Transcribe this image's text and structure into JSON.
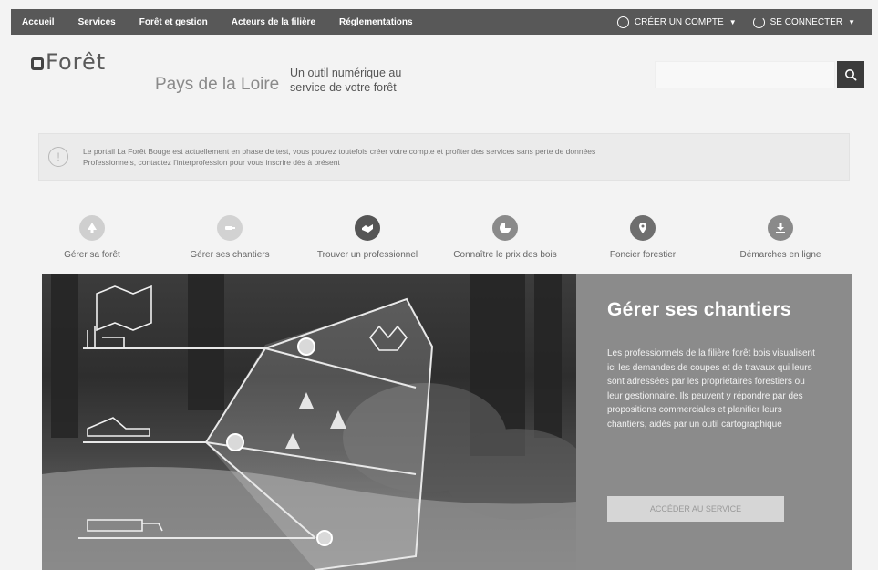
{
  "nav": {
    "items": [
      "Accueil",
      "Services",
      "Forêt et gestion",
      "Acteurs de la filière",
      "Réglementations"
    ],
    "create_account": "CRÉER UN COMPTE",
    "login": "SE CONNECTER"
  },
  "header": {
    "logo_text": "Forêt",
    "region": "Pays de la Loire",
    "tagline_line1": "Un outil numérique au",
    "tagline_line2": "service de votre forêt"
  },
  "search": {
    "placeholder": ""
  },
  "notice": {
    "line1": "Le portail La Forêt Bouge est actuellement en phase de test, vous pouvez toutefois créer votre compte et profiter des services sans perte de données",
    "line2": "Professionnels, contactez l'interprofession pour vous inscrire dès à présent"
  },
  "shortcuts": [
    {
      "label": "Gérer sa forêt",
      "icon": "tree-icon",
      "color": "#cfcfcf"
    },
    {
      "label": "Gérer ses chantiers",
      "icon": "chainsaw-icon",
      "color": "#d2d2d2"
    },
    {
      "label": "Trouver un professionnel",
      "icon": "handshake-icon",
      "color": "#555555"
    },
    {
      "label": "Connaître le prix des bois",
      "icon": "euro-chart-icon",
      "color": "#8a8a8a"
    },
    {
      "label": "Foncier forestier",
      "icon": "location-pin-icon",
      "color": "#6e6e6e"
    },
    {
      "label": "Démarches en ligne",
      "icon": "download-icon",
      "color": "#8a8a8a"
    }
  ],
  "hero": {
    "title": "Gérer ses chantiers",
    "body": "Les professionnels de la filière forêt bois visualisent ici les demandes de coupes et de travaux qui leurs sont adressées par les propriétaires forestiers ou leur gestionnaire. Ils peuvent y répondre par des propositions commerciales et planifier leurs chantiers, aidés par un outil cartographique",
    "cta": "ACCÉDER AU SERVICE"
  }
}
